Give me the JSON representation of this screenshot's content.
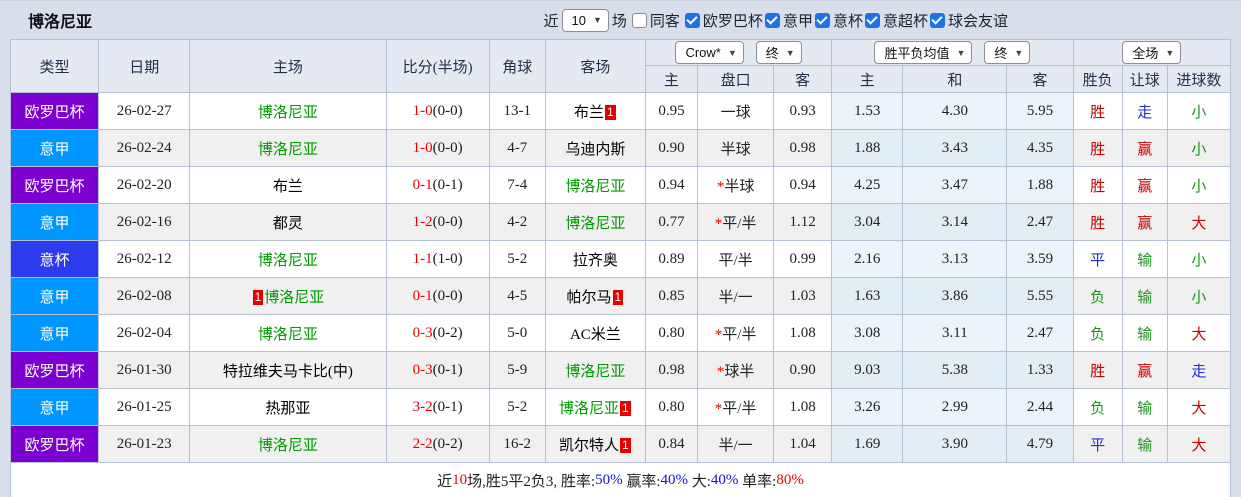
{
  "title": "博洛尼亚",
  "topbar": {
    "recent_label": "近",
    "recent_count": "10",
    "games_label": "场",
    "same_away": {
      "label": "同客",
      "checked": false
    },
    "leagues": [
      {
        "label": "欧罗巴杯",
        "checked": true
      },
      {
        "label": "意甲",
        "checked": true
      },
      {
        "label": "意杯",
        "checked": true
      },
      {
        "label": "意超杯",
        "checked": true
      },
      {
        "label": "球会友谊",
        "checked": true
      }
    ]
  },
  "header": {
    "dropdowns": {
      "asia_company": "Crow*",
      "asia_time": "终",
      "euro_company": "胜平负均值",
      "euro_time": "终",
      "scope": "全场"
    },
    "columns": [
      "类型",
      "日期",
      "主场",
      "比分(半场)",
      "角球",
      "客场"
    ],
    "sub_columns": [
      "主",
      "盘口",
      "客",
      "主",
      "和",
      "客",
      "胜负",
      "让球",
      "进球数"
    ]
  },
  "colors": {
    "leagues": {
      "europa": "#7c00d0",
      "seriea": "#0096ff",
      "coppa": "#2c3bee"
    },
    "team_green": "#009900",
    "result_red": "#c80000",
    "result_blue": "#2330c8",
    "result_green": "#1e9320"
  },
  "rows": [
    {
      "league": "欧罗巴杯",
      "league_key": "europa",
      "date": "26-02-27",
      "home": {
        "name": "博洛尼亚",
        "green": true,
        "badge": null,
        "badge_pos": null
      },
      "score": "1-0",
      "half_score": "(0-0)",
      "corner": "13-1",
      "away": {
        "name": "布兰",
        "green": false,
        "badge": "1",
        "badge_pos": "after"
      },
      "asia": {
        "home": "0.95",
        "handicap": "一球",
        "star": false,
        "away": "0.93"
      },
      "europe": {
        "home": "1.53",
        "draw": "4.30",
        "away": "5.95"
      },
      "results": [
        {
          "text": "胜",
          "color": "red"
        },
        {
          "text": "走",
          "color": "blue"
        },
        {
          "text": "小",
          "color": "green"
        }
      ]
    },
    {
      "league": "意甲",
      "league_key": "seriea",
      "date": "26-02-24",
      "home": {
        "name": "博洛尼亚",
        "green": true,
        "badge": null,
        "badge_pos": null
      },
      "score": "1-0",
      "half_score": "(0-0)",
      "corner": "4-7",
      "away": {
        "name": "乌迪内斯",
        "green": false,
        "badge": null,
        "badge_pos": null
      },
      "asia": {
        "home": "0.90",
        "handicap": "半球",
        "star": false,
        "away": "0.98"
      },
      "europe": {
        "home": "1.88",
        "draw": "3.43",
        "away": "4.35"
      },
      "results": [
        {
          "text": "胜",
          "color": "red"
        },
        {
          "text": "赢",
          "color": "red"
        },
        {
          "text": "小",
          "color": "green"
        }
      ]
    },
    {
      "league": "欧罗巴杯",
      "league_key": "europa",
      "date": "26-02-20",
      "home": {
        "name": "布兰",
        "green": false,
        "badge": null,
        "badge_pos": null
      },
      "score": "0-1",
      "half_score": "(0-1)",
      "corner": "7-4",
      "away": {
        "name": "博洛尼亚",
        "green": true,
        "badge": null,
        "badge_pos": null
      },
      "asia": {
        "home": "0.94",
        "handicap": "半球",
        "star": true,
        "away": "0.94"
      },
      "europe": {
        "home": "4.25",
        "draw": "3.47",
        "away": "1.88"
      },
      "results": [
        {
          "text": "胜",
          "color": "red"
        },
        {
          "text": "赢",
          "color": "red"
        },
        {
          "text": "小",
          "color": "green"
        }
      ]
    },
    {
      "league": "意甲",
      "league_key": "seriea",
      "date": "26-02-16",
      "home": {
        "name": "都灵",
        "green": false,
        "badge": null,
        "badge_pos": null
      },
      "score": "1-2",
      "half_score": "(0-0)",
      "corner": "4-2",
      "away": {
        "name": "博洛尼亚",
        "green": true,
        "badge": null,
        "badge_pos": null
      },
      "asia": {
        "home": "0.77",
        "handicap": "平/半",
        "star": true,
        "away": "1.12"
      },
      "europe": {
        "home": "3.04",
        "draw": "3.14",
        "away": "2.47"
      },
      "results": [
        {
          "text": "胜",
          "color": "red"
        },
        {
          "text": "赢",
          "color": "red"
        },
        {
          "text": "大",
          "color": "red"
        }
      ]
    },
    {
      "league": "意杯",
      "league_key": "coppa",
      "date": "26-02-12",
      "home": {
        "name": "博洛尼亚",
        "green": true,
        "badge": null,
        "badge_pos": null
      },
      "score": "1-1",
      "half_score": "(1-0)",
      "corner": "5-2",
      "away": {
        "name": "拉齐奥",
        "green": false,
        "badge": null,
        "badge_pos": null
      },
      "asia": {
        "home": "0.89",
        "handicap": "平/半",
        "star": false,
        "away": "0.99"
      },
      "europe": {
        "home": "2.16",
        "draw": "3.13",
        "away": "3.59"
      },
      "results": [
        {
          "text": "平",
          "color": "blue"
        },
        {
          "text": "输",
          "color": "green"
        },
        {
          "text": "小",
          "color": "green"
        }
      ]
    },
    {
      "league": "意甲",
      "league_key": "seriea",
      "date": "26-02-08",
      "home": {
        "name": "博洛尼亚",
        "green": true,
        "badge": "1",
        "badge_pos": "before"
      },
      "score": "0-1",
      "half_score": "(0-0)",
      "corner": "4-5",
      "away": {
        "name": "帕尔马",
        "green": false,
        "badge": "1",
        "badge_pos": "after"
      },
      "asia": {
        "home": "0.85",
        "handicap": "半/一",
        "star": false,
        "away": "1.03"
      },
      "europe": {
        "home": "1.63",
        "draw": "3.86",
        "away": "5.55"
      },
      "results": [
        {
          "text": "负",
          "color": "green"
        },
        {
          "text": "输",
          "color": "green"
        },
        {
          "text": "小",
          "color": "green"
        }
      ]
    },
    {
      "league": "意甲",
      "league_key": "seriea",
      "date": "26-02-04",
      "home": {
        "name": "博洛尼亚",
        "green": true,
        "badge": null,
        "badge_pos": null
      },
      "score": "0-3",
      "half_score": "(0-2)",
      "corner": "5-0",
      "away": {
        "name": "AC米兰",
        "green": false,
        "badge": null,
        "badge_pos": null
      },
      "asia": {
        "home": "0.80",
        "handicap": "平/半",
        "star": true,
        "away": "1.08"
      },
      "europe": {
        "home": "3.08",
        "draw": "3.11",
        "away": "2.47"
      },
      "results": [
        {
          "text": "负",
          "color": "green"
        },
        {
          "text": "输",
          "color": "green"
        },
        {
          "text": "大",
          "color": "red"
        }
      ]
    },
    {
      "league": "欧罗巴杯",
      "league_key": "europa",
      "date": "26-01-30",
      "home": {
        "name": "特拉维夫马卡比(中)",
        "green": false,
        "badge": null,
        "badge_pos": null
      },
      "score": "0-3",
      "half_score": "(0-1)",
      "corner": "5-9",
      "away": {
        "name": "博洛尼亚",
        "green": true,
        "badge": null,
        "badge_pos": null
      },
      "asia": {
        "home": "0.98",
        "handicap": "球半",
        "star": true,
        "away": "0.90"
      },
      "europe": {
        "home": "9.03",
        "draw": "5.38",
        "away": "1.33"
      },
      "results": [
        {
          "text": "胜",
          "color": "red"
        },
        {
          "text": "赢",
          "color": "red"
        },
        {
          "text": "走",
          "color": "blue"
        }
      ]
    },
    {
      "league": "意甲",
      "league_key": "seriea",
      "date": "26-01-25",
      "home": {
        "name": "热那亚",
        "green": false,
        "badge": null,
        "badge_pos": null
      },
      "score": "3-2",
      "half_score": "(0-1)",
      "corner": "5-2",
      "away": {
        "name": "博洛尼亚",
        "green": true,
        "badge": "1",
        "badge_pos": "after"
      },
      "asia": {
        "home": "0.80",
        "handicap": "平/半",
        "star": true,
        "away": "1.08"
      },
      "europe": {
        "home": "3.26",
        "draw": "2.99",
        "away": "2.44"
      },
      "results": [
        {
          "text": "负",
          "color": "green"
        },
        {
          "text": "输",
          "color": "green"
        },
        {
          "text": "大",
          "color": "red"
        }
      ]
    },
    {
      "league": "欧罗巴杯",
      "league_key": "europa",
      "date": "26-01-23",
      "home": {
        "name": "博洛尼亚",
        "green": true,
        "badge": null,
        "badge_pos": null
      },
      "score": "2-2",
      "half_score": "(0-2)",
      "corner": "16-2",
      "away": {
        "name": "凯尔特人",
        "green": false,
        "badge": "1",
        "badge_pos": "after"
      },
      "asia": {
        "home": "0.84",
        "handicap": "半/一",
        "star": false,
        "away": "1.04"
      },
      "europe": {
        "home": "1.69",
        "draw": "3.90",
        "away": "4.79"
      },
      "results": [
        {
          "text": "平",
          "color": "blue"
        },
        {
          "text": "输",
          "color": "green"
        },
        {
          "text": "大",
          "color": "red"
        }
      ]
    }
  ],
  "footer": {
    "segments": [
      {
        "text": "近",
        "color": "black"
      },
      {
        "text": "10",
        "color": "red"
      },
      {
        "text": "场,胜5平2负3, 胜率:",
        "color": "black"
      },
      {
        "text": "50%",
        "color": "blue"
      },
      {
        "text": " 赢率:",
        "color": "black"
      },
      {
        "text": "40%",
        "color": "blue"
      },
      {
        "text": " 大:",
        "color": "black"
      },
      {
        "text": "40%",
        "color": "blue"
      },
      {
        "text": " 单率:",
        "color": "black"
      },
      {
        "text": "80%",
        "color": "red"
      }
    ]
  }
}
